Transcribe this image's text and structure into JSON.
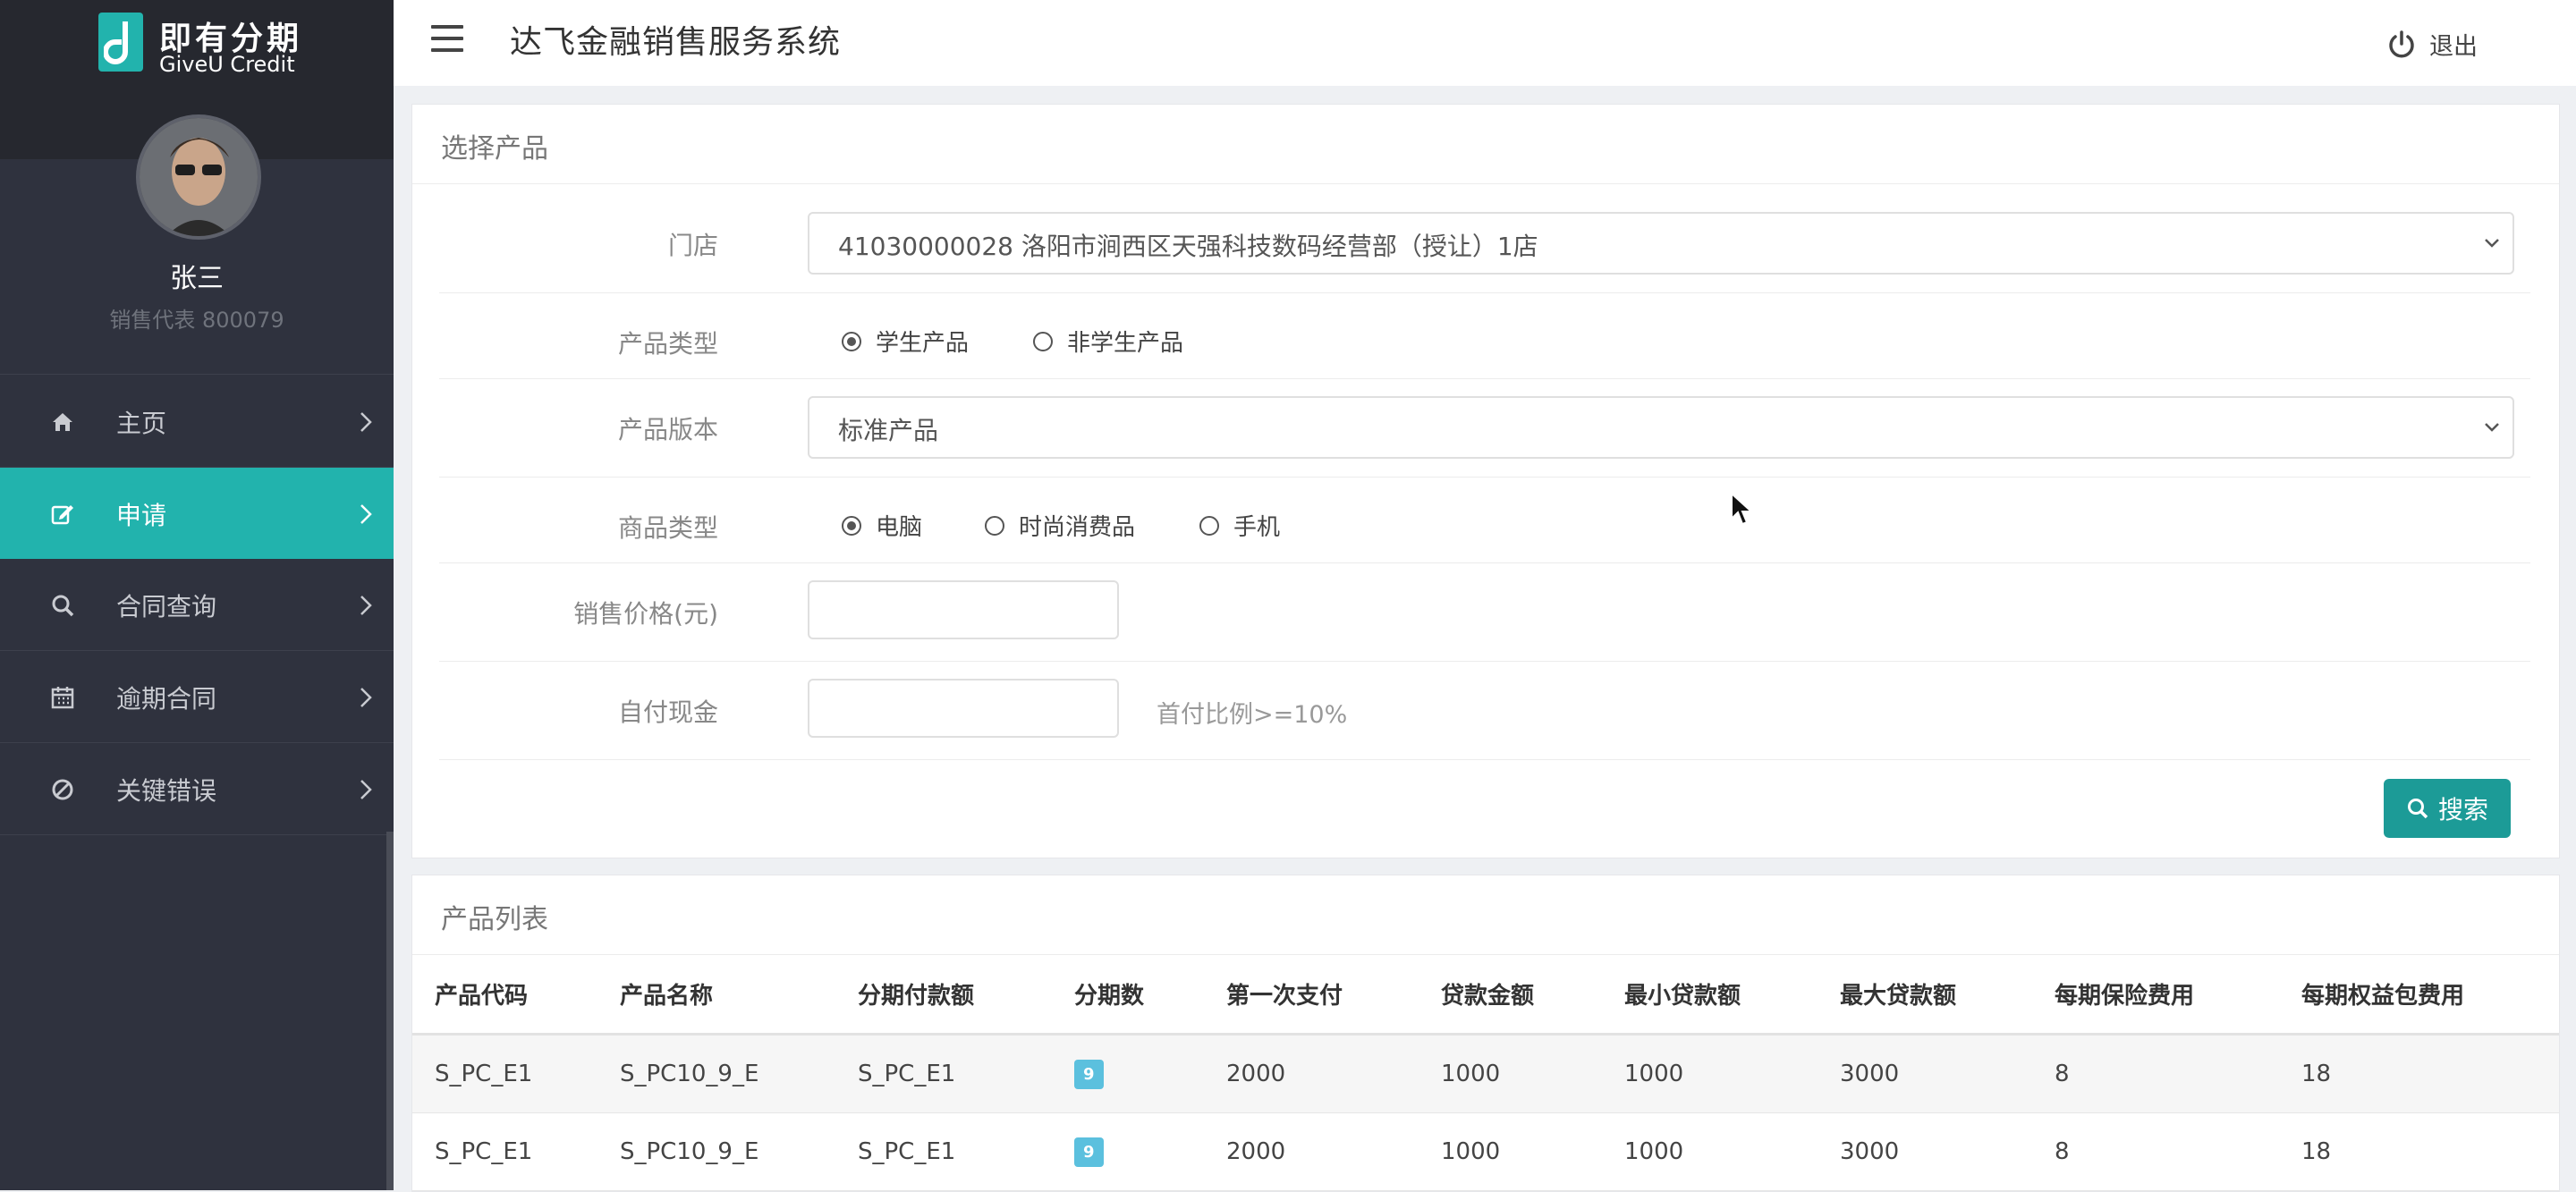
{
  "brand": {
    "name_cn": "即有分期",
    "name_en": "GiveU Credit"
  },
  "user": {
    "name": "张三",
    "role": "销售代表 800079"
  },
  "nav": [
    {
      "label": "主页",
      "icon": "home-icon",
      "active": false
    },
    {
      "label": "申请",
      "icon": "edit-icon",
      "active": true
    },
    {
      "label": "合同查询",
      "icon": "search-icon",
      "active": false
    },
    {
      "label": "逾期合同",
      "icon": "calendar-icon",
      "active": false
    },
    {
      "label": "关键错误",
      "icon": "ban-icon",
      "active": false
    }
  ],
  "header": {
    "title": "达飞金融销售服务系统",
    "logout_label": "退出"
  },
  "form": {
    "panel_title": "选择产品",
    "store": {
      "label": "门店",
      "value": "41030000028 洛阳市涧西区天强科技数码经营部（授让）1店"
    },
    "product_type": {
      "label": "产品类型",
      "options": [
        "学生产品",
        "非学生产品"
      ],
      "selected": "学生产品"
    },
    "product_version": {
      "label": "产品版本",
      "value": "标准产品"
    },
    "goods_type": {
      "label": "商品类型",
      "options": [
        "电脑",
        "时尚消费品",
        "手机"
      ],
      "selected": "电脑"
    },
    "sale_price": {
      "label": "销售价格(元)",
      "value": ""
    },
    "down_payment": {
      "label": "自付现金",
      "value": "",
      "hint": "首付比例>=10%"
    },
    "search_label": "搜索"
  },
  "product_list": {
    "panel_title": "产品列表",
    "columns": [
      "产品代码",
      "产品名称",
      "分期付款额",
      "分期数",
      "第一次支付",
      "贷款金额",
      "最小贷款额",
      "最大贷款额",
      "每期保险费用",
      "每期权益包费用"
    ],
    "rows": [
      [
        "S_PC_E1",
        "S_PC10_9_E",
        "S_PC_E1",
        "9",
        "2000",
        "1000",
        "1000",
        "3000",
        "8",
        "18"
      ],
      [
        "S_PC_E1",
        "S_PC10_9_E",
        "S_PC_E1",
        "9",
        "2000",
        "1000",
        "1000",
        "3000",
        "8",
        "18"
      ]
    ]
  },
  "colors": {
    "sidebar": "#2f323e",
    "accent": "#22b3ad",
    "button": "#1c9b97",
    "badge": "#5bc0de"
  }
}
